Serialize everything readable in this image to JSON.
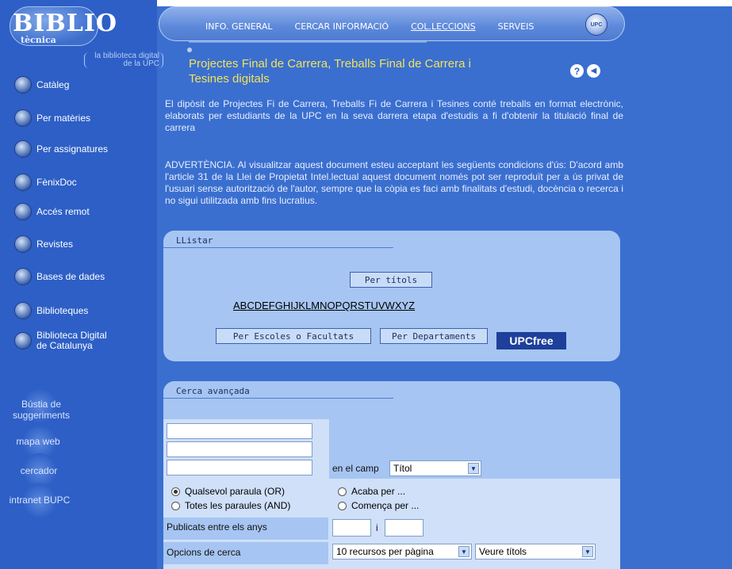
{
  "logo": {
    "name": "BIBLIO",
    "sub": "tècnica",
    "tagline": "la biblioteca digital de la UPC"
  },
  "header": {
    "menu": [
      {
        "label": "INFO. GENERAL"
      },
      {
        "label": "CERCAR INFORMACIÓ"
      },
      {
        "label": "COL.LECCIONS"
      },
      {
        "label": "SERVEIS"
      }
    ],
    "grid_badge": "UPC"
  },
  "sidebar": {
    "items": [
      {
        "label": "Catàleg"
      },
      {
        "label": "Per matèries"
      },
      {
        "label": "Per assignatures"
      },
      {
        "label": "FènixDoc"
      },
      {
        "label": "Accés remot"
      },
      {
        "label": "Revistes"
      },
      {
        "label": "Bases de dades"
      },
      {
        "label": "Biblioteques"
      },
      {
        "label": "Biblioteca Digital"
      },
      {
        "label": "de Catalunya"
      }
    ],
    "links": [
      {
        "label": "Bústia de"
      },
      {
        "label": "suggeriments"
      },
      {
        "label": "mapa web"
      },
      {
        "label": "cercador"
      },
      {
        "label": "intranet BUPC"
      }
    ]
  },
  "page": {
    "title_line1": "Projectes Final de Carrera, Treballs Final de Carrera i",
    "title_line2": "Tesines digitals",
    "intro": "El dipòsit de Projectes Fi de Carrera, Treballs Fi de Carrera i Tesines conté treballs en format electrònic, elaborats per estudiants de la UPC en la seva darrera etapa d'estudis a fi d'obtenir la titulació final de carrera",
    "warning": "ADVERTÈNCIA. Al visualitzar aquest document esteu acceptant les següents condicions d'ús: D'acord amb l'article 31 de la Llei de Propietat Intel.lectual aquest document només pot ser reproduït per a ús privat de l'usuari sense autorització de l'autor, sempre que la còpia es faci amb finalitats d'estudi, docència o recerca i no sigui utilitzada amb fins lucratius."
  },
  "llistar": {
    "heading": "LListar",
    "per_titols": "Per títols",
    "letters": [
      "A",
      "B",
      "C",
      "D",
      "E",
      "F",
      "G",
      "H",
      "I",
      "J",
      "K",
      "L",
      "M",
      "N",
      "O",
      "P",
      "Q",
      "R",
      "S",
      "T",
      "U",
      "V",
      "W",
      "X",
      "Y",
      "Z"
    ],
    "per_escoles": "Per Escoles o Facultats",
    "per_departaments": "Per Departaments",
    "upcfree": "UPCfree"
  },
  "cerca": {
    "heading": "Cerca avançada",
    "field_label": "en el camp",
    "field_value": "Títol",
    "radio_or": "Qualsevol paraula (OR)",
    "radio_and": "Totes les paraules (AND)",
    "radio_acaba": "Acaba per ...",
    "radio_comenca": "Comença per ...",
    "anys_label": "Publicats entre els anys",
    "anys_sep": "i",
    "opcions_label": "Opcions de cerca",
    "per_pagina": "10 recursos per pàgina",
    "veure": "Veure títols"
  }
}
